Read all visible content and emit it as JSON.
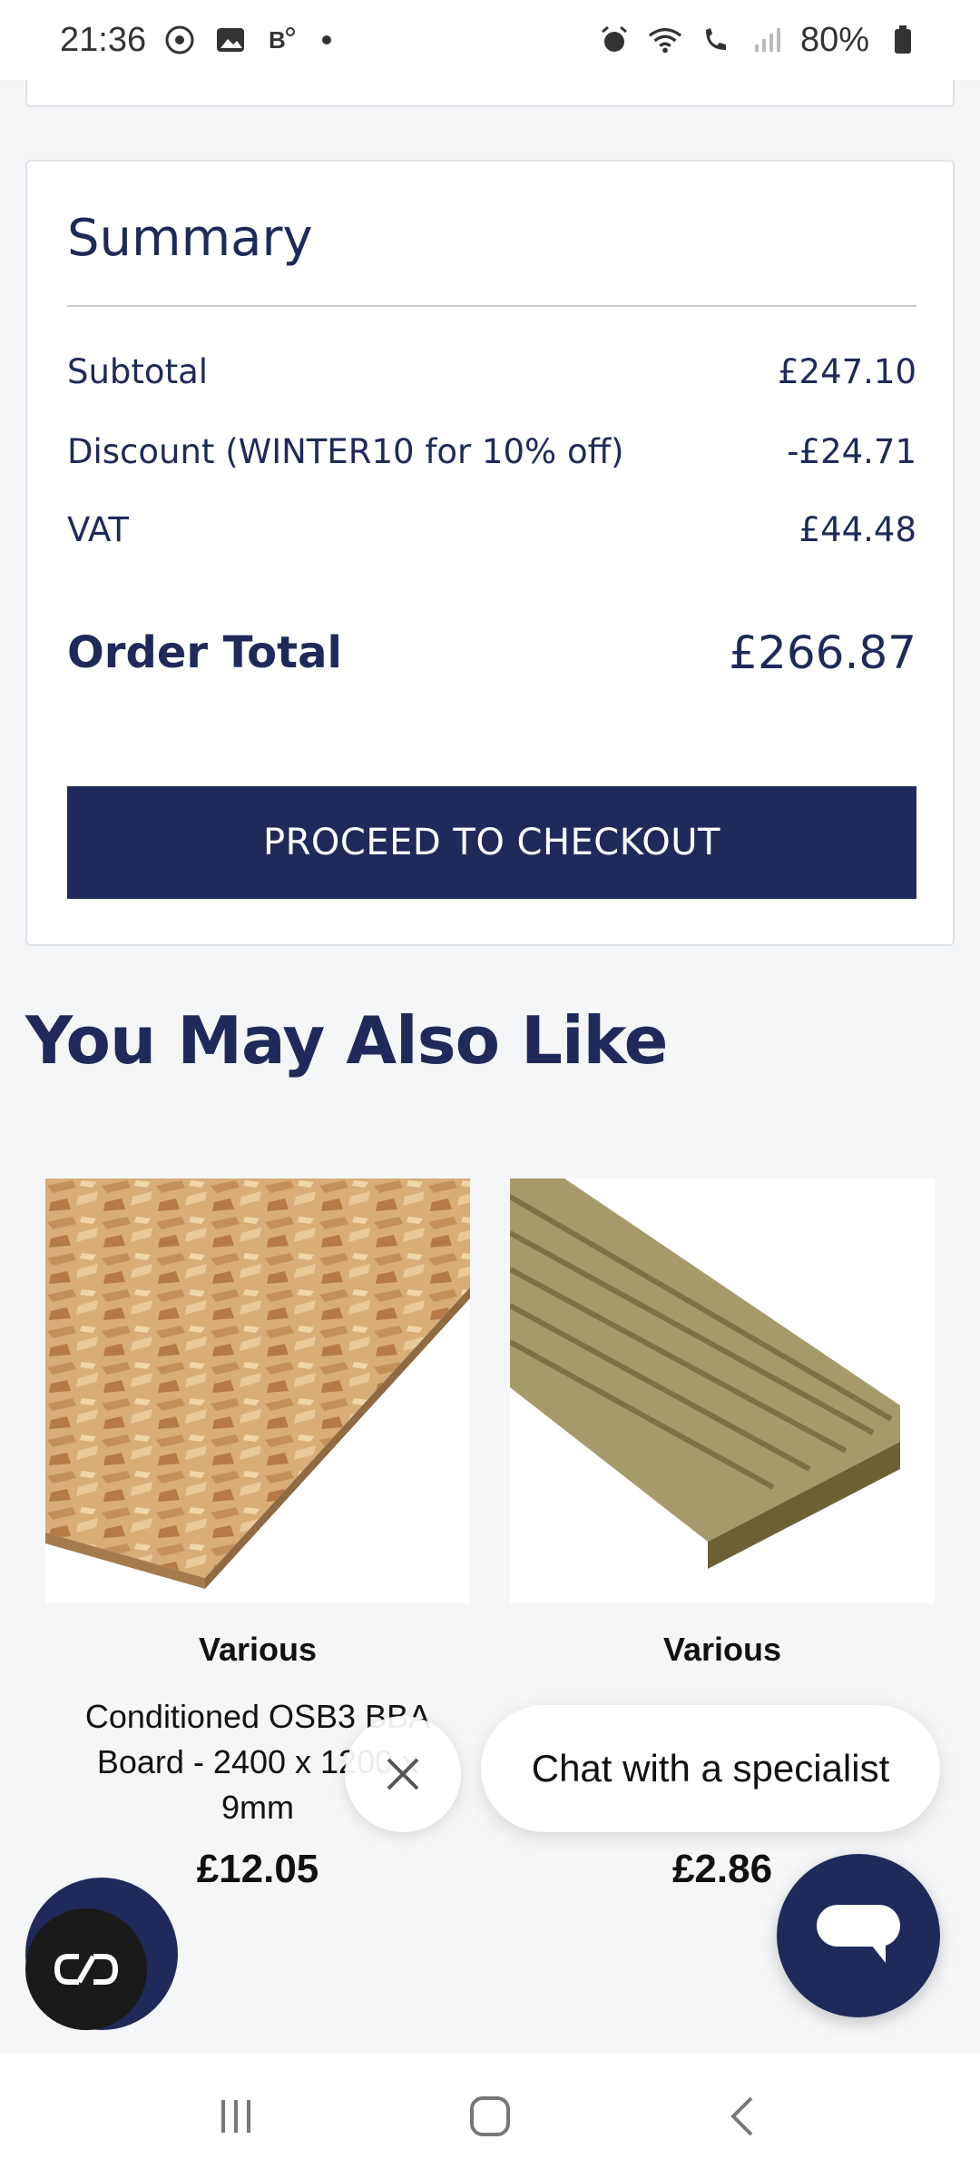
{
  "status_bar": {
    "time": "21:36",
    "battery": "80%",
    "left_icons": [
      "face-icon",
      "gallery-icon",
      "b-app-icon"
    ],
    "right_icons": [
      "alarm-icon",
      "wifi-icon",
      "wifi-call-icon",
      "signal-icon",
      "battery-icon"
    ]
  },
  "summary": {
    "title": "Summary",
    "rows": [
      {
        "label": "Subtotal",
        "value": "£247.10"
      },
      {
        "label": "Discount (WINTER10 for 10% off)",
        "value": "-£24.71"
      },
      {
        "label": "VAT",
        "value": "£44.48"
      }
    ],
    "total_label": "Order Total",
    "total_value": "£266.87",
    "checkout_label": "PROCEED TO CHECKOUT"
  },
  "recommendations": {
    "title": "You May Also Like",
    "products": [
      {
        "brand": "Various",
        "name": "Conditioned OSB3 BBA Board - 2400 x 1200 x 9mm",
        "price": "£12.05"
      },
      {
        "brand": "Various",
        "name": "",
        "price": "£2.86"
      }
    ]
  },
  "chat": {
    "bubble_text": "Chat with a specialist"
  },
  "colors": {
    "brand_navy": "#1f2a5a",
    "page_bg": "#f5f6f7"
  },
  "nav": [
    "recents-icon",
    "home-icon",
    "back-icon"
  ]
}
